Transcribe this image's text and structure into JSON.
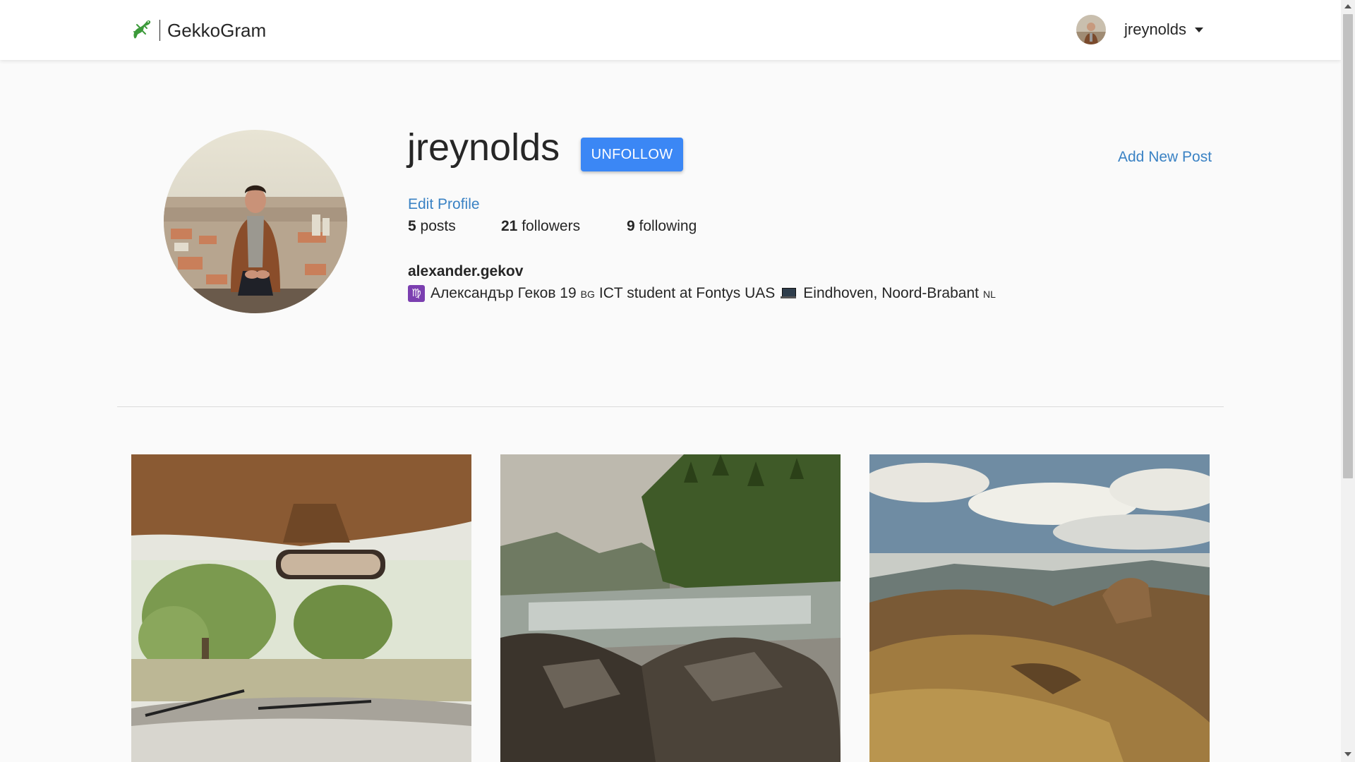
{
  "navbar": {
    "brand_name": "GekkoGram",
    "current_user": "jreynolds"
  },
  "profile": {
    "username": "jreynolds",
    "follow_button_label": "UNFOLLOW",
    "add_post_label": "Add New Post",
    "edit_profile_label": "Edit Profile",
    "stats": {
      "posts_count": "5",
      "posts_label": "posts",
      "followers_count": "21",
      "followers_label": "followers",
      "following_count": "9",
      "following_label": "following"
    },
    "full_name": "alexander.gekov",
    "bio": {
      "virgo_symbol": "♍",
      "part1": "Александър Геков 19",
      "flag1": "BG",
      "part2": "ICT student at Fontys UAS",
      "part3": "Eindhoven, Noord-Brabant",
      "flag2": "NL"
    }
  },
  "posts": [
    {
      "icon": "car-interior-photo"
    },
    {
      "icon": "river-forest-photo"
    },
    {
      "icon": "mountain-landscape-photo"
    }
  ],
  "colors": {
    "accent": "#3b87f5",
    "link": "#3a82c4",
    "background": "#fafafa"
  }
}
